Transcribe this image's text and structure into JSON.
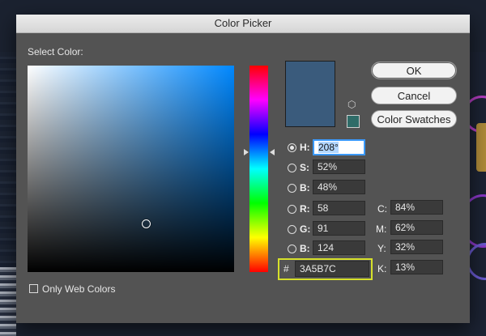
{
  "dialog": {
    "title": "Color Picker"
  },
  "select_color_label": "Select Color:",
  "buttons": {
    "ok": "OK",
    "cancel": "Cancel",
    "swatches": "Color Swatches"
  },
  "colors": {
    "current": "#3A5B7C",
    "websafe": "#2f6c68",
    "accent_outline": "#d6e02a"
  },
  "hsb": [
    {
      "label": "H:",
      "value": "208°",
      "selected": true
    },
    {
      "label": "S:",
      "value": "52%",
      "selected": false
    },
    {
      "label": "B:",
      "value": "48%",
      "selected": false
    }
  ],
  "rgb": [
    {
      "label": "R:",
      "value": "58"
    },
    {
      "label": "G:",
      "value": "91"
    },
    {
      "label": "B:",
      "value": "124"
    }
  ],
  "cmyk": [
    {
      "label": "C:",
      "value": "84%"
    },
    {
      "label": "M:",
      "value": "62%"
    },
    {
      "label": "Y:",
      "value": "32%"
    },
    {
      "label": "K:",
      "value": "13%"
    }
  ],
  "hex": {
    "symbol": "#",
    "value": "3A5B7C"
  },
  "only_web_colors": "Only Web Colors"
}
